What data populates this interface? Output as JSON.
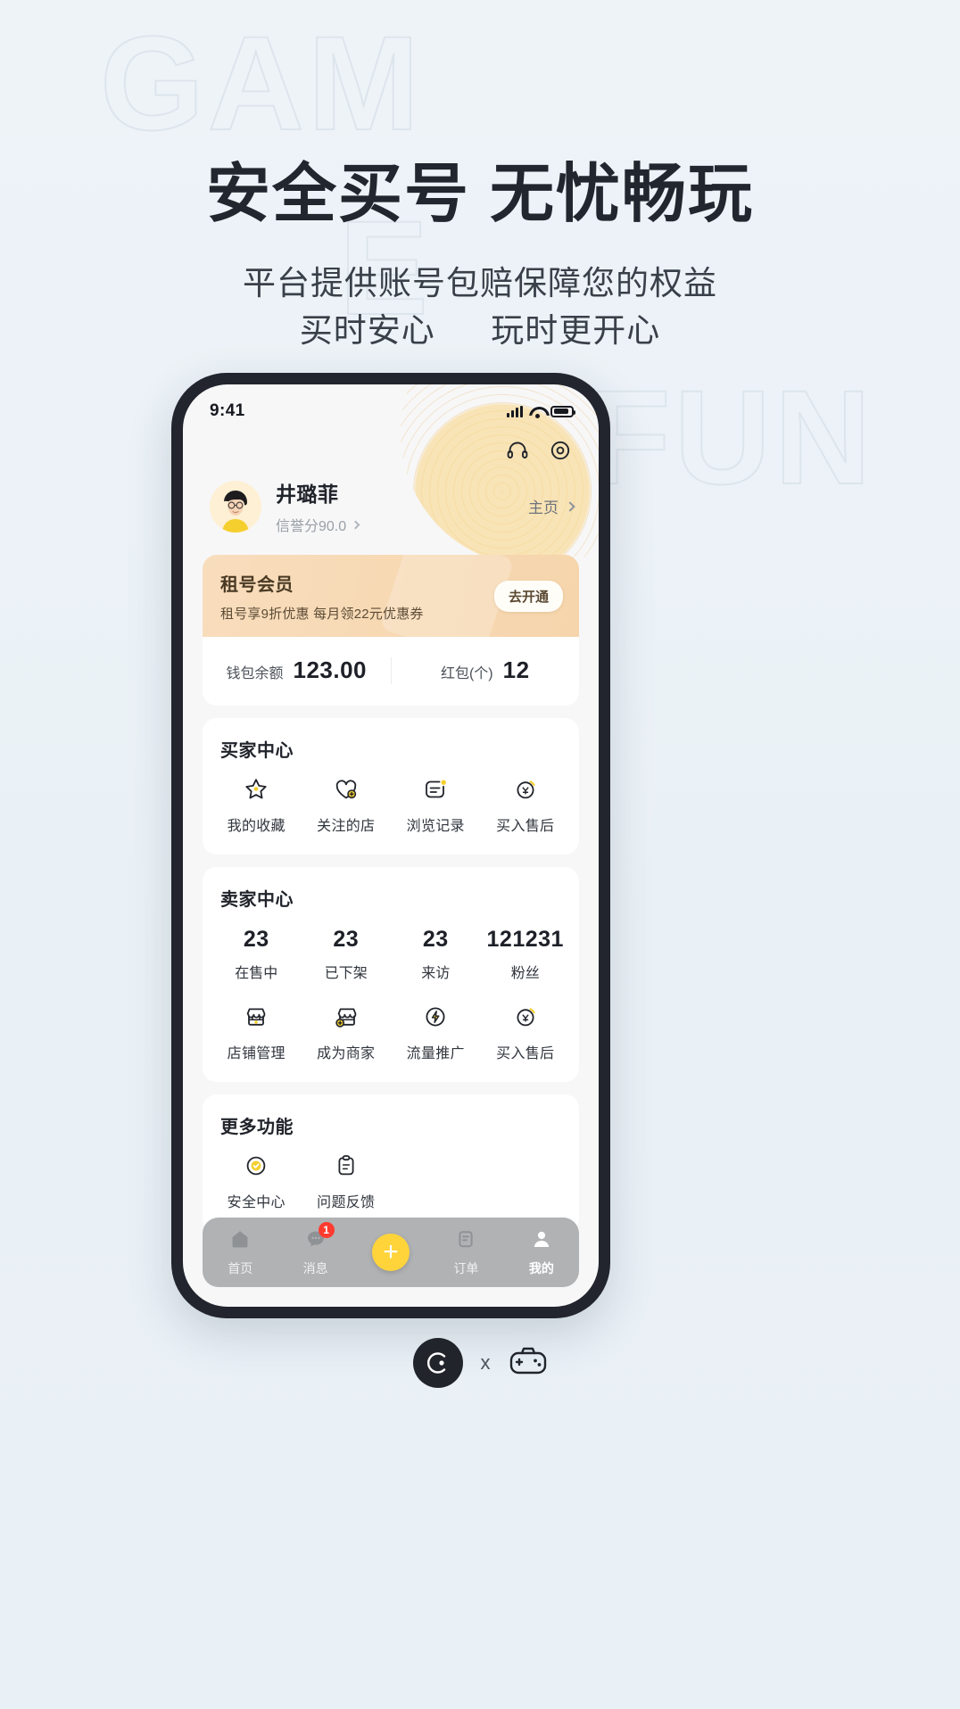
{
  "poster": {
    "ghost_words": [
      "GAM",
      "E",
      "FUN"
    ],
    "headline": "安全买号 无忧畅玩",
    "subline_1": "平台提供账号包赔保障您的权益",
    "subline_2_left": "买时安心",
    "subline_2_right": "玩时更开心"
  },
  "statusbar": {
    "time": "9:41",
    "signal_icon": "signal-bars-icon",
    "wifi_icon": "wifi-icon",
    "battery_icon": "battery-icon"
  },
  "header": {
    "support_icon": "headset-icon",
    "settings_icon": "gear-icon"
  },
  "profile": {
    "avatar": "user-avatar",
    "name": "井璐菲",
    "score": "信誉分90.0",
    "home_label": "主页"
  },
  "member": {
    "title": "租号会员",
    "subtitle": "租号享9折优惠 每月领22元优惠券",
    "button": "去开通"
  },
  "wallet": {
    "cells": [
      {
        "label": "钱包余额",
        "value": "123.00"
      },
      {
        "label": "红包(个)",
        "value": "12"
      }
    ]
  },
  "buyer_center": {
    "title": "买家中心",
    "items": [
      {
        "label": "我的收藏",
        "icon": "star-icon"
      },
      {
        "label": "关注的店",
        "icon": "heart-shop-icon"
      },
      {
        "label": "浏览记录",
        "icon": "history-note-icon"
      },
      {
        "label": "买入售后",
        "icon": "refund-icon"
      }
    ]
  },
  "seller_center": {
    "title": "卖家中心",
    "stats": [
      {
        "value": "23",
        "label": "在售中"
      },
      {
        "value": "23",
        "label": "已下架"
      },
      {
        "value": "23",
        "label": "来访"
      },
      {
        "value": "121231",
        "label": "粉丝"
      }
    ],
    "items": [
      {
        "label": "店铺管理",
        "icon": "shop-icon"
      },
      {
        "label": "成为商家",
        "icon": "shop-plus-icon"
      },
      {
        "label": "流量推广",
        "icon": "bolt-icon"
      },
      {
        "label": "买入售后",
        "icon": "refund-icon"
      }
    ]
  },
  "more_features": {
    "title": "更多功能",
    "items": [
      {
        "label": "安全中心",
        "icon": "shield-check-icon"
      },
      {
        "label": "问题反馈",
        "icon": "clipboard-icon"
      }
    ]
  },
  "tabbar": {
    "tabs": [
      {
        "label": "首页",
        "icon": "home-icon",
        "active": false,
        "badge": ""
      },
      {
        "label": "消息",
        "icon": "message-icon",
        "active": false,
        "badge": "1"
      },
      {
        "label": "",
        "icon": "plus-icon",
        "active": false,
        "badge": ""
      },
      {
        "label": "订单",
        "icon": "order-icon",
        "active": false,
        "badge": ""
      },
      {
        "label": "我的",
        "icon": "person-icon",
        "active": true,
        "badge": ""
      }
    ]
  },
  "footer": {
    "brand_icon": "brand-logo-icon",
    "separator": "x",
    "partner_icon": "gamepad-icon"
  },
  "colors": {
    "background": "#eef3f7",
    "headline": "#22262e",
    "member_card": "#f7d9b4",
    "accent_yellow": "#ffd43b",
    "badge_red": "#ff3b30",
    "tabbar": "#b0b2b4"
  }
}
